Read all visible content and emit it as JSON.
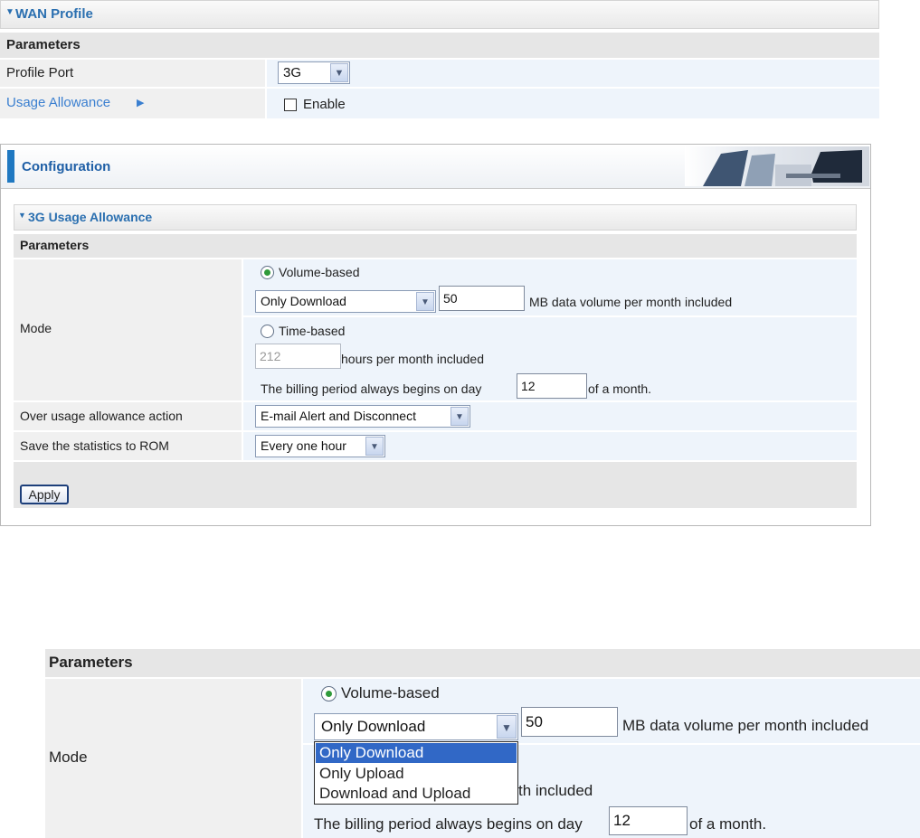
{
  "wan_profile": {
    "title": "WAN Profile",
    "params_header": "Parameters",
    "profile_port_label": "Profile Port",
    "profile_port_value": "3G",
    "usage_allowance_label": "Usage Allowance",
    "enable_label": "Enable"
  },
  "config": {
    "title": "Configuration",
    "section_title": "3G Usage Allowance",
    "params_header": "Parameters",
    "mode_label": "Mode",
    "volume_based_label": "Volume-based",
    "volume_based_checked": true,
    "direction_value": "Only Download",
    "volume_value": "50",
    "volume_suffix": "MB data volume per month included",
    "time_based_label": "Time-based",
    "time_based_checked": false,
    "hours_value": "212",
    "hours_suffix": "hours per month included",
    "billing_prefix": "The billing period always begins on day",
    "billing_day": "12",
    "billing_suffix": "of a month.",
    "over_usage_label": "Over usage allowance action",
    "over_usage_value": "E-mail Alert and Disconnect",
    "save_stats_label": "Save the statistics to ROM",
    "save_stats_value": "Every one hour",
    "apply_label": "Apply"
  },
  "zoom": {
    "params_header": "Parameters",
    "mode_label": "Mode",
    "volume_based_label": "Volume-based",
    "direction_value": "Only Download",
    "volume_value": "50",
    "volume_suffix": "MB data volume per month included",
    "dropdown_options": [
      "Only Download",
      "Only Upload",
      "Download and Upload"
    ],
    "hidden_suffix_fragment": "th included",
    "billing_prefix": "The billing period always begins on day",
    "billing_day": "12",
    "billing_suffix": "of a month."
  },
  "colors": {
    "accent": "#2a6fb0",
    "highlight": "#3168c6",
    "radio_on": "#2f9a3a"
  }
}
